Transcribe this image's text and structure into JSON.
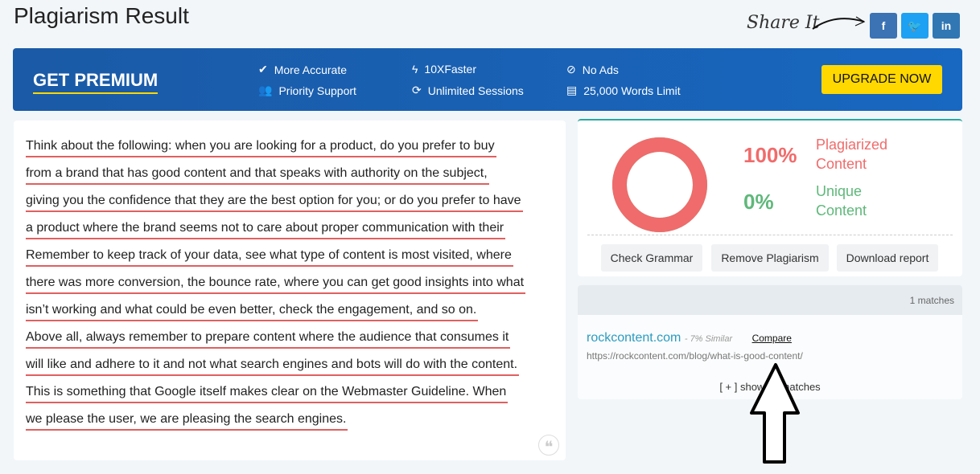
{
  "page_title": "Plagiarism Result",
  "share": {
    "label": "Share It",
    "buttons": [
      {
        "icon": "facebook-icon",
        "glyph": "f",
        "color": "#3b73b4"
      },
      {
        "icon": "twitter-icon",
        "glyph": "t",
        "color": "#1da1f2"
      },
      {
        "icon": "linkedin-icon",
        "glyph": "in",
        "color": "#3077b4"
      }
    ]
  },
  "premium": {
    "title": "GET PREMIUM",
    "features": [
      "More Accurate",
      "Priority Support",
      "10XFaster",
      "Unlimited Sessions",
      "No Ads",
      "25,000 Words Limit"
    ],
    "upgrade_label": "UPGRADE NOW"
  },
  "text_lines": [
    "Think about the following: when you are looking for a product, do you prefer to buy",
    "from a brand that has good content and that speaks with authority on the subject,",
    "giving you the confidence that they are the best option for you; or do you prefer to have",
    "a product where the brand seems not to care about proper communication with their",
    "Remember to keep track of your data, see what type of content is most visited, where",
    "there was more conversion, the bounce rate, where you can get good insights into what",
    "isn’t working and what could be even better, check the engagement, and so on.",
    "Above all, always remember to prepare content where the audience that consumes it",
    "will like and adhere to it and not what search engines and bots will do with the content.",
    "This is something that Google itself makes clear on the Webmaster Guideline. When",
    "we please the user, we are pleasing the search engines."
  ],
  "result": {
    "plagiarized_pct": "100%",
    "plagiarized_label": "Plagiarized Content",
    "unique_pct": "0%",
    "unique_label": "Unique Content",
    "plagiarized_fraction": 1.0,
    "colors": {
      "plagiarized": "#f06b6b",
      "unique": "#5fb87a"
    },
    "buttons": [
      "Check Grammar",
      "Remove Plagiarism",
      "Download report"
    ]
  },
  "matches": {
    "count_label": "1 matches",
    "items": [
      {
        "site": "rockcontent.com",
        "similar": "- 7% Similar",
        "compare": "Compare",
        "url": "https://rockcontent.com/blog/what-is-good-content/"
      }
    ],
    "show_all": "[ + ] show all matches"
  }
}
